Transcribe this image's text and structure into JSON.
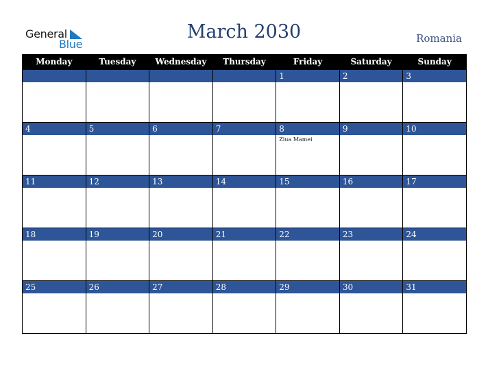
{
  "logo": {
    "general": "General",
    "blue": "Blue"
  },
  "title": "March 2030",
  "country": "Romania",
  "colors": {
    "band": "#2e5597",
    "header": "#000000",
    "title": "#253f6e",
    "logo_blue": "#1f7ac2"
  },
  "weekdays": [
    "Monday",
    "Tuesday",
    "Wednesday",
    "Thursday",
    "Friday",
    "Saturday",
    "Sunday"
  ],
  "weeks": [
    [
      {
        "day": ""
      },
      {
        "day": ""
      },
      {
        "day": ""
      },
      {
        "day": ""
      },
      {
        "day": "1"
      },
      {
        "day": "2"
      },
      {
        "day": "3"
      }
    ],
    [
      {
        "day": "4"
      },
      {
        "day": "5"
      },
      {
        "day": "6"
      },
      {
        "day": "7"
      },
      {
        "day": "8",
        "event": "Ziua Mamei"
      },
      {
        "day": "9"
      },
      {
        "day": "10"
      }
    ],
    [
      {
        "day": "11"
      },
      {
        "day": "12"
      },
      {
        "day": "13"
      },
      {
        "day": "14"
      },
      {
        "day": "15"
      },
      {
        "day": "16"
      },
      {
        "day": "17"
      }
    ],
    [
      {
        "day": "18"
      },
      {
        "day": "19"
      },
      {
        "day": "20"
      },
      {
        "day": "21"
      },
      {
        "day": "22"
      },
      {
        "day": "23"
      },
      {
        "day": "24"
      }
    ],
    [
      {
        "day": "25"
      },
      {
        "day": "26"
      },
      {
        "day": "27"
      },
      {
        "day": "28"
      },
      {
        "day": "29"
      },
      {
        "day": "30"
      },
      {
        "day": "31"
      }
    ]
  ]
}
